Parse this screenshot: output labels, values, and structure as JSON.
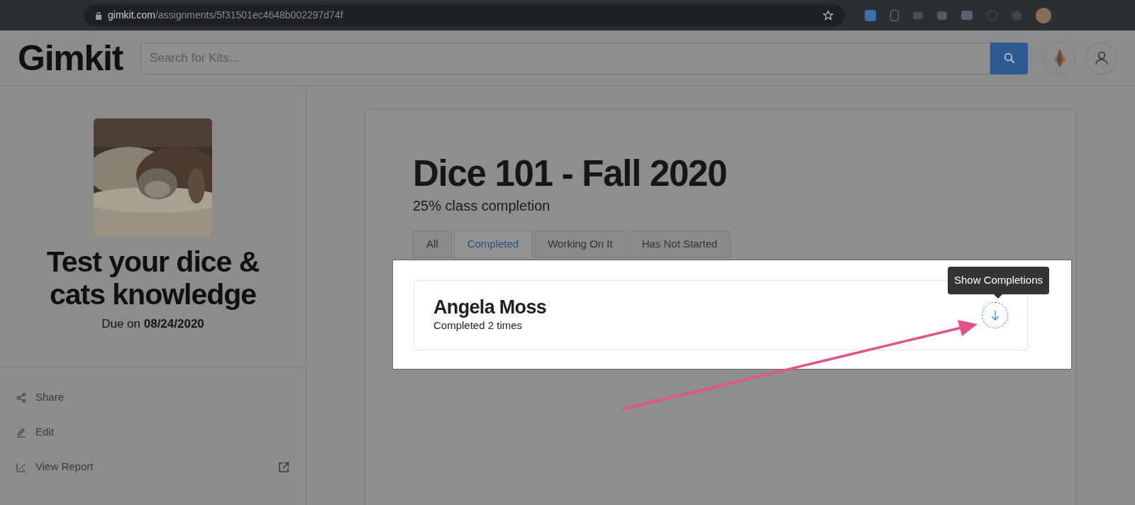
{
  "browser": {
    "url_host": "gimkit.com",
    "url_path": "/assignments/5f31501ec4648b002297d74f"
  },
  "header": {
    "logo": "Gimkit",
    "search": {
      "placeholder": "Search for Kits..."
    }
  },
  "sidebar": {
    "title": "Test your dice & cats knowledge",
    "due": "Due on **08/24/2020**",
    "actions": [
      {
        "kind": "share",
        "label": "Share"
      },
      {
        "kind": "edit",
        "label": "Edit"
      },
      {
        "kind": "report",
        "label": "View Report"
      }
    ]
  },
  "assignment": {
    "title": "Dice 101 - Fall 2020",
    "completion": "25% class completion",
    "tabs": [
      {
        "label": "All",
        "selected": false
      },
      {
        "label": "Completed",
        "selected": true
      },
      {
        "label": "Working On It",
        "selected": false
      },
      {
        "label": "Has Not Started",
        "selected": false
      }
    ],
    "students": [
      {
        "name": "Angela Moss",
        "detail": "Completed 2 times",
        "tooltip": "Show Completions"
      }
    ]
  }
}
